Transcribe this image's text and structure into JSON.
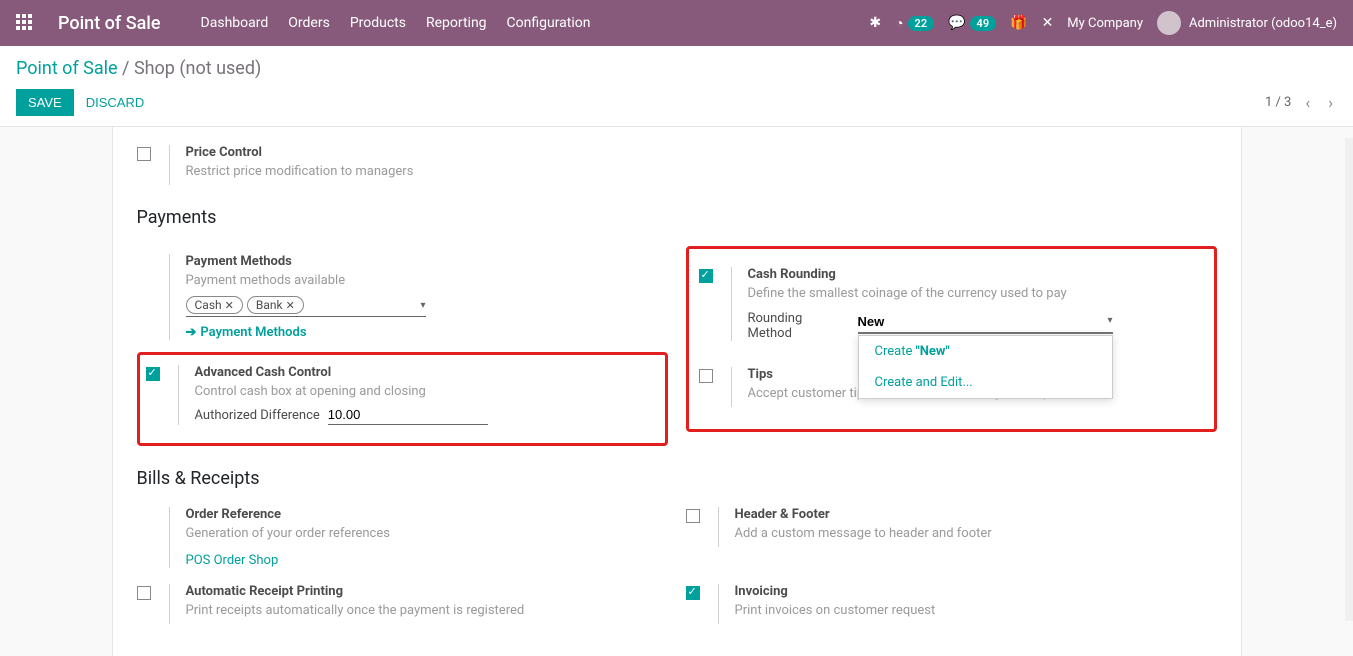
{
  "topbar": {
    "brand": "Point of Sale",
    "nav": [
      "Dashboard",
      "Orders",
      "Products",
      "Reporting",
      "Configuration"
    ],
    "badge1": "22",
    "badge2": "49",
    "company": "My Company",
    "user": "Administrator (odoo14_e)"
  },
  "breadcrumb": {
    "root": "Point of Sale",
    "sep": " / ",
    "current": "Shop (not used)"
  },
  "buttons": {
    "save": "SAVE",
    "discard": "DISCARD"
  },
  "pager": "1 / 3",
  "price_control": {
    "title": "Price Control",
    "help": "Restrict price modification to managers"
  },
  "section_payments": "Payments",
  "payment_methods": {
    "title": "Payment Methods",
    "help": "Payment methods available",
    "tags": [
      "Cash",
      "Bank"
    ],
    "link": "Payment Methods"
  },
  "adv_cash": {
    "title": "Advanced Cash Control",
    "help": "Control cash box at opening and closing",
    "auth_diff_label": "Authorized Difference",
    "auth_diff_value": "10.00"
  },
  "cash_rounding": {
    "title": "Cash Rounding",
    "help": "Define the smallest coinage of the currency used to pay",
    "method_label": "Rounding Method",
    "method_value": "New",
    "dd_create_prefix": "Create ",
    "dd_create_value": "\"New\"",
    "dd_create_edit": "Create and Edit..."
  },
  "tips": {
    "title": "Tips",
    "help": "Accept customer tips or convert their change to a tip"
  },
  "section_bills": "Bills & Receipts",
  "order_ref": {
    "title": "Order Reference",
    "help": "Generation of your order references",
    "link": "POS Order Shop"
  },
  "header_footer": {
    "title": "Header & Footer",
    "help": "Add a custom message to header and footer"
  },
  "auto_receipt": {
    "title": "Automatic Receipt Printing",
    "help": "Print receipts automatically once the payment is registered"
  },
  "invoicing": {
    "title": "Invoicing",
    "help": "Print invoices on customer request"
  }
}
